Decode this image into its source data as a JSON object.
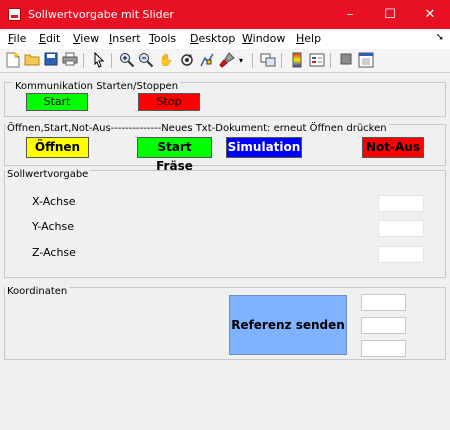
{
  "window": {
    "title": "Sollwertvorgabe mit Slider",
    "minimize_glyph": "–",
    "maximize_glyph": "☐",
    "close_glyph": "✕"
  },
  "menu": {
    "file": {
      "u": "F",
      "rest": "ile"
    },
    "edit": {
      "u": "E",
      "rest": "dit"
    },
    "view": {
      "u": "V",
      "rest": "iew"
    },
    "insert": {
      "u": "I",
      "rest": "nsert"
    },
    "tools": {
      "u": "T",
      "rest": "ools"
    },
    "desktop": {
      "u": "D",
      "rest": "esktop"
    },
    "window": {
      "u": "W",
      "rest": "indow"
    },
    "help": {
      "u": "H",
      "rest": "elp"
    },
    "dock_arrow": "➘"
  },
  "toolbar_icons": [
    "new-file-icon",
    "open-folder-icon",
    "save-icon",
    "print-icon",
    "pointer-icon",
    "zoom-in-icon",
    "zoom-out-icon",
    "pan-hand-icon",
    "rotate-3d-icon",
    "data-cursor-icon",
    "brush-icon",
    "link-plot-icon",
    "colorbar-icon",
    "legend-icon",
    "hide-plot-tools-icon",
    "show-plot-tools-icon"
  ],
  "panels": {
    "kommunikation": {
      "title": "Kommunikation Starten/Stoppen",
      "start_label": "Start",
      "stop_label": "Stop"
    },
    "oeffnen": {
      "title": "Öffnen,Start,Not-Aus--------------Neues Txt-Dokument: erneut Öffnen drücken",
      "oeffnen_label": "Öffnen",
      "start_fraese_label": "Start Fräse",
      "simulation_label": "Simulation",
      "notaus_label": "Not-Aus"
    },
    "sollwert": {
      "title": "Sollwertvorgabe",
      "x_label": "X-Achse",
      "y_label": "Y-Achse",
      "z_label": "Z-Achse"
    },
    "koordinaten": {
      "title": "Koordinaten",
      "referenz_label": "Referenz senden"
    }
  },
  "colors": {
    "title_bar": "#e81123",
    "start": "#00ff00",
    "stop": "#ff0000",
    "oeffnen": "#ffff00",
    "start_fraese": "#00ff00",
    "simulation": "#0000ff",
    "notaus": "#ff0000",
    "referenz": "#80b3ff"
  }
}
